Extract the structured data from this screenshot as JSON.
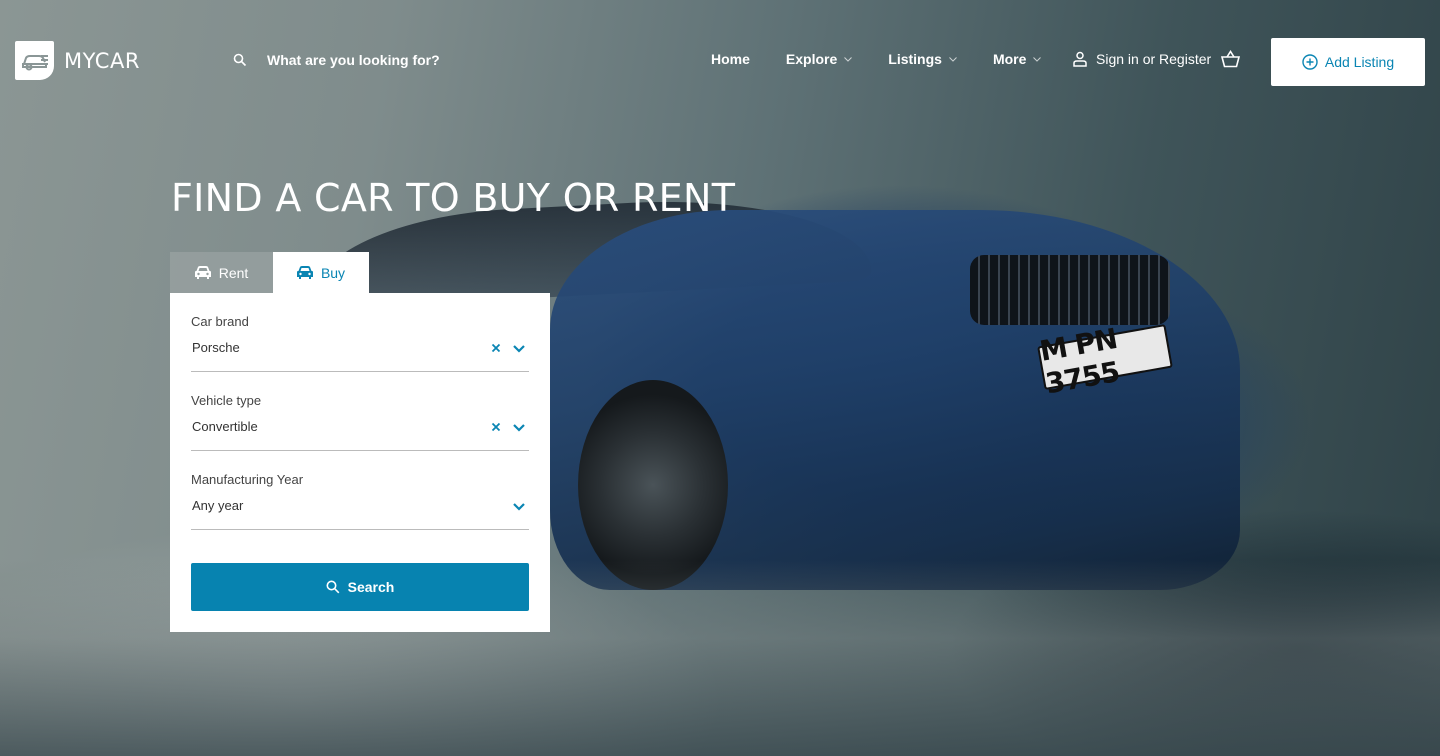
{
  "brand": {
    "name": "MYCAR",
    "logo_icon": "car-logo-icon"
  },
  "search": {
    "placeholder": "What are you looking for?",
    "icon": "search-icon"
  },
  "nav": {
    "items": [
      {
        "label": "Home",
        "has_dropdown": false
      },
      {
        "label": "Explore",
        "has_dropdown": true
      },
      {
        "label": "Listings",
        "has_dropdown": true
      },
      {
        "label": "More",
        "has_dropdown": true
      }
    ],
    "signin_label": "Sign in or Register",
    "basket_icon": "basket-icon",
    "add_listing_label": "Add Listing"
  },
  "hero": {
    "title": "FIND A CAR TO BUY OR RENT",
    "plate_text": "M PN 3755"
  },
  "tabs": [
    {
      "label": "Rent",
      "icon": "car-icon",
      "active": false
    },
    {
      "label": "Buy",
      "icon": "car-icon",
      "active": true
    }
  ],
  "form": {
    "fields": [
      {
        "label": "Car brand",
        "value": "Porsche",
        "clearable": true
      },
      {
        "label": "Vehicle type",
        "value": "Convertible",
        "clearable": true
      },
      {
        "label": "Manufacturing Year",
        "value": "Any year",
        "clearable": false
      }
    ],
    "submit_label": "Search"
  },
  "colors": {
    "accent": "#0783b0",
    "accent_text": "#0a85b3"
  }
}
